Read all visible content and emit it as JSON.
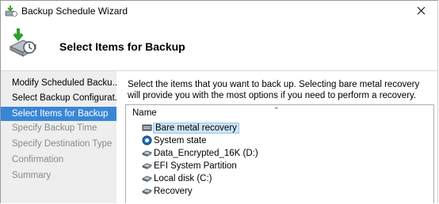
{
  "window": {
    "title": "Backup Schedule Wizard"
  },
  "header": {
    "title": "Select Items for Backup",
    "icon": "backup-clock-icon"
  },
  "sidebar": {
    "steps": [
      {
        "label": "Modify Scheduled Backu...",
        "state": "done"
      },
      {
        "label": "Select Backup Configurat...",
        "state": "done"
      },
      {
        "label": "Select Items for Backup",
        "state": "active"
      },
      {
        "label": "Specify Backup Time",
        "state": "disabled"
      },
      {
        "label": "Specify Destination Type",
        "state": "disabled"
      },
      {
        "label": "Confirmation",
        "state": "disabled"
      },
      {
        "label": "Summary",
        "state": "disabled"
      }
    ]
  },
  "main": {
    "description": "Select the items that you want to back up. Selecting bare metal recovery will provide you with the most options if you need to perform a recovery.",
    "list": {
      "column_header": "Name",
      "items": [
        {
          "label": "Bare metal recovery",
          "icon": "server-icon",
          "selected": true
        },
        {
          "label": "System state",
          "icon": "system-state-icon",
          "selected": false
        },
        {
          "label": "Data_Encrypted_16K (D:)",
          "icon": "drive-icon",
          "selected": false
        },
        {
          "label": "EFI System Partition",
          "icon": "drive-icon",
          "selected": false
        },
        {
          "label": "Local disk (C:)",
          "icon": "drive-icon",
          "selected": false
        },
        {
          "label": "Recovery",
          "icon": "drive-icon",
          "selected": false
        }
      ]
    }
  },
  "colors": {
    "active_step": "#3a86d6",
    "sidebar_bg": "#eeeeee",
    "selection_bg": "#cce4f7"
  }
}
